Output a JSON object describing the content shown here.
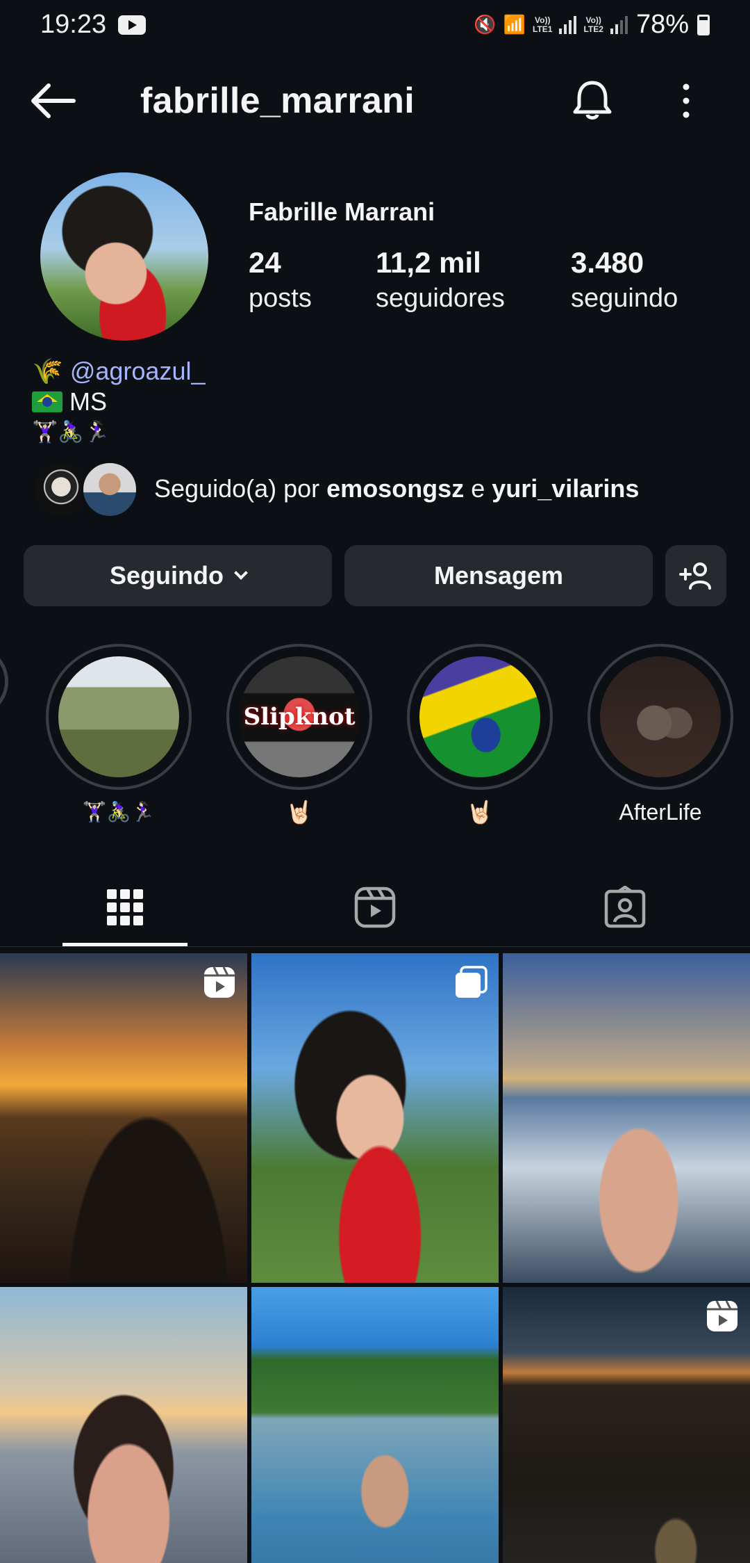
{
  "status_bar": {
    "time": "19:23",
    "battery": "78%",
    "lte1": "Vo)) LTE1",
    "lte2": "Vo)) LTE2"
  },
  "header": {
    "username": "fabrille_marrani",
    "back_icon": "arrow-left-icon",
    "bell_icon": "bell-icon",
    "more_icon": "more-vertical-icon"
  },
  "profile": {
    "display_name": "Fabrille Marrani",
    "stats": [
      {
        "value": "24",
        "label": "posts"
      },
      {
        "value": "11,2 mil",
        "label": "seguidores"
      },
      {
        "value": "3.480",
        "label": "seguindo"
      }
    ],
    "bio": {
      "line1_emoji": "🌾",
      "line1_link": "@agroazul_",
      "line2_text": "MS",
      "line3_emoji": "🏋🏻‍♀️🚴🏻‍♀️🏃🏻‍♀️"
    },
    "followed_by": {
      "prefix": "Seguido(a) por ",
      "user1": "emosongsz",
      "joiner": " e ",
      "user2": "yuri_vilarins"
    }
  },
  "actions": {
    "following": "Seguindo",
    "message": "Mensagem",
    "add_user_icon": "add-person-icon"
  },
  "highlights": [
    {
      "label": "🏋🏻‍♀️🚴🏻‍♀️🏃🏻‍♀️",
      "overlay": ""
    },
    {
      "label": "🤘🏻",
      "overlay": "Slipknot"
    },
    {
      "label": "🤘🏻",
      "overlay": ""
    },
    {
      "label": "AfterLife",
      "overlay": ""
    }
  ],
  "tabs": [
    {
      "icon": "grid-icon",
      "active": true
    },
    {
      "icon": "reels-icon",
      "active": false
    },
    {
      "icon": "tagged-icon",
      "active": false
    }
  ],
  "posts": [
    {
      "badge": "reel"
    },
    {
      "badge": "carousel"
    },
    {
      "badge": ""
    },
    {
      "badge": ""
    },
    {
      "badge": ""
    },
    {
      "badge": "reel"
    }
  ]
}
